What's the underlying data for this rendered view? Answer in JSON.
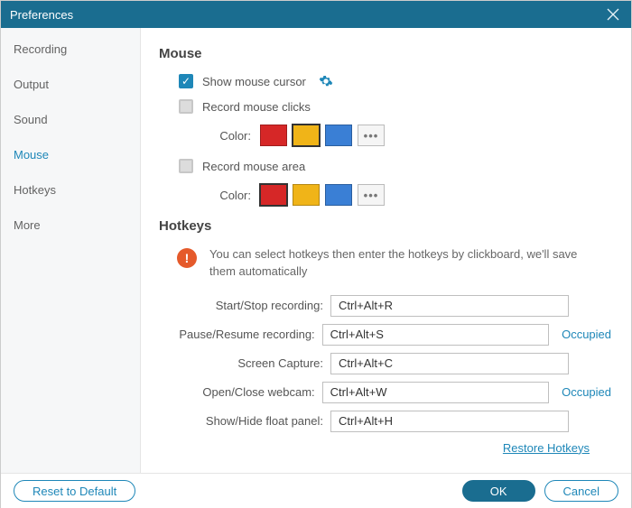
{
  "window": {
    "title": "Preferences"
  },
  "sidebar": {
    "items": [
      {
        "label": "Recording"
      },
      {
        "label": "Output"
      },
      {
        "label": "Sound"
      },
      {
        "label": "Mouse"
      },
      {
        "label": "Hotkeys"
      },
      {
        "label": "More"
      }
    ],
    "active_index": 3
  },
  "mouse": {
    "heading": "Mouse",
    "show_cursor_label": "Show mouse cursor",
    "show_cursor_checked": true,
    "record_clicks_label": "Record mouse clicks",
    "record_clicks_checked": false,
    "clicks_color_label": "Color:",
    "clicks_colors": [
      "#d62727",
      "#f0b418",
      "#3a7fd5"
    ],
    "clicks_selected_index": 1,
    "record_area_label": "Record mouse area",
    "record_area_checked": false,
    "area_color_label": "Color:",
    "area_colors": [
      "#d62727",
      "#f0b418",
      "#3a7fd5"
    ],
    "area_selected_index": 0,
    "more_label": "•••"
  },
  "hotkeys": {
    "heading": "Hotkeys",
    "hint": "You can select hotkeys then enter the hotkeys by clickboard, we'll save them automatically",
    "rows": [
      {
        "label": "Start/Stop recording:",
        "value": "Ctrl+Alt+R",
        "occupied": false
      },
      {
        "label": "Pause/Resume recording:",
        "value": "Ctrl+Alt+S",
        "occupied": true
      },
      {
        "label": "Screen Capture:",
        "value": "Ctrl+Alt+C",
        "occupied": false
      },
      {
        "label": "Open/Close webcam:",
        "value": "Ctrl+Alt+W",
        "occupied": true
      },
      {
        "label": "Show/Hide float panel:",
        "value": "Ctrl+Alt+H",
        "occupied": false
      }
    ],
    "occupied_label": "Occupied",
    "restore_label": "Restore Hotkeys"
  },
  "footer": {
    "reset_label": "Reset to Default",
    "ok_label": "OK",
    "cancel_label": "Cancel"
  }
}
